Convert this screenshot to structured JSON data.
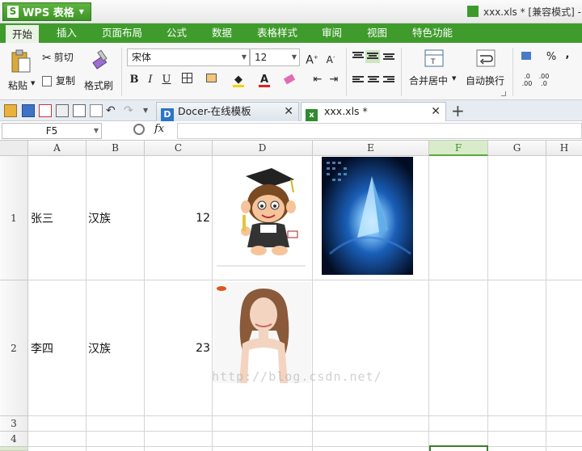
{
  "titlebar": {
    "app_label": "WPS 表格",
    "app_logo_letter": "S",
    "doc_title": "xxx.xls * [兼容模式] -"
  },
  "menu": {
    "tabs": [
      "开始",
      "插入",
      "页面布局",
      "公式",
      "数据",
      "表格样式",
      "审阅",
      "视图",
      "特色功能"
    ]
  },
  "ribbon": {
    "paste": "粘贴",
    "cut": "剪切",
    "copy": "复制",
    "format_painter": "格式刷",
    "font_name": "宋体",
    "font_size": "12",
    "merge_center": "合并居中",
    "wrap_text": "自动换行",
    "percent": "%",
    "comma": ","
  },
  "tabs": {
    "docer_tab": "Docer-在线模板",
    "file_tab": "xxx.xls *"
  },
  "formula": {
    "name_box": "F5",
    "fx_label": "fx",
    "value": ""
  },
  "grid": {
    "columns": [
      "A",
      "B",
      "C",
      "D",
      "E",
      "F",
      "G",
      "H"
    ],
    "selected_column": "F",
    "rows": [
      "1",
      "2",
      "3",
      "4"
    ],
    "data": [
      {
        "name": "张三",
        "ethnicity": "汉族",
        "number": "12",
        "picture_d": "cartoon-graduate-image",
        "picture_e": "blue-tech-image"
      },
      {
        "name": "李四",
        "ethnicity": "汉族",
        "number": "23",
        "picture_d": "woman-portrait-image"
      }
    ],
    "watermark": "http://blog.csdn.net/"
  },
  "colors": {
    "accent_green": "#3f9c2c",
    "selected_header": "#d9ecc9"
  }
}
